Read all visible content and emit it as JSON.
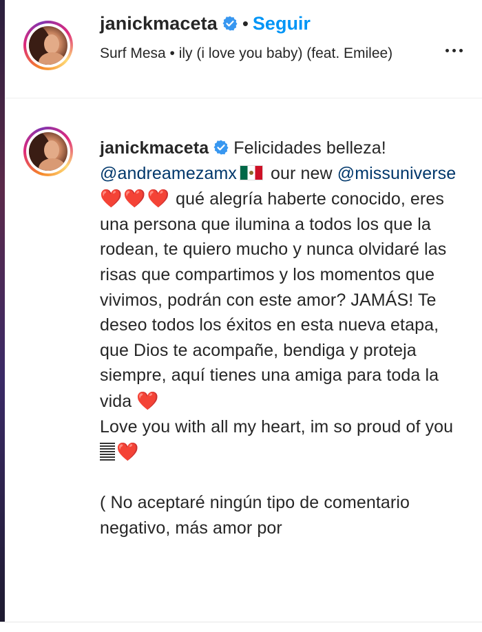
{
  "post_header": {
    "username": "janickmaceta",
    "separator": "•",
    "follow_label": "Seguir",
    "audio": "Surf Mesa • ily (i love you baby) (feat. Emilee)",
    "more_icon": "more-horizontal-icon"
  },
  "caption": {
    "username": "janickmaceta",
    "text_1": "Felicidades belleza! ",
    "mention_1": "@andreamezamx",
    "text_2": " our new ",
    "mention_2": "@missuniverse",
    "hearts_1": "❤️❤️❤️",
    "text_3": " qué alegría haberte conocido, eres una persona que ilumina a todos los que la rodean, te quiero mucho y nunca olvidaré las risas que compartimos y los momentos que vivimos, podrán con este amor? JAMÁS! Te deseo todos los éxitos en esta nueva etapa, que Dios te acompañe, bendiga y proteja siempre, aquí tienes una amiga para toda la vida ",
    "hearts_2": "❤️",
    "text_4": "Love you with all my heart, im so proud of you ",
    "hearts_3": "❤️",
    "text_5": "( No aceptaré ningún tipo de comentario negativo, más amor por"
  },
  "colors": {
    "link_blue": "#0095f6",
    "mention": "#00376b",
    "verified_blue": "#3897f0",
    "heart_red": "#ed1c24"
  }
}
